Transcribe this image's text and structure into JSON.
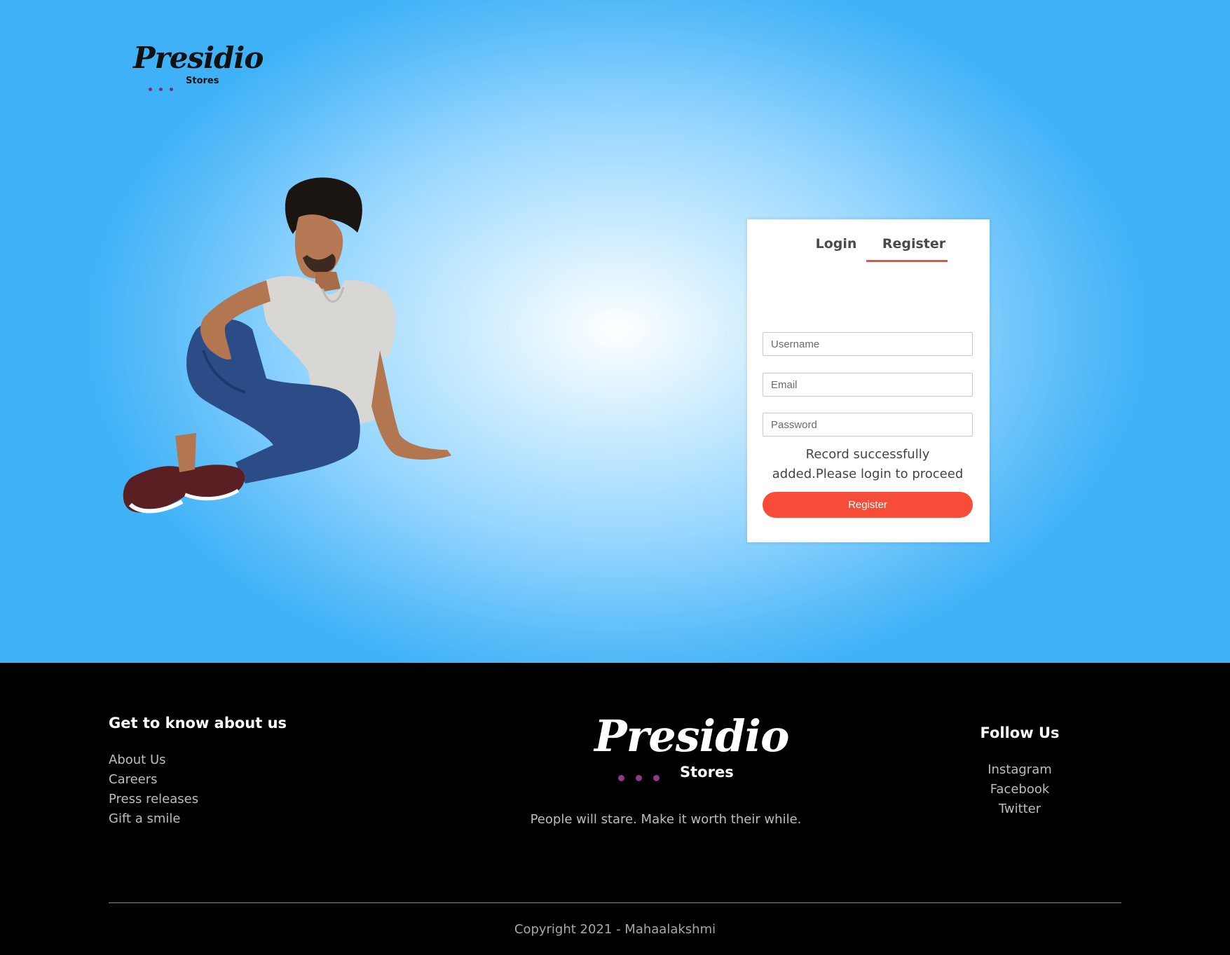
{
  "brand": {
    "logo_script": "Presidio",
    "logo_sub": "Stores",
    "accent_color": "#f64c38"
  },
  "auth_card": {
    "tabs": [
      {
        "label": "Login",
        "active": false
      },
      {
        "label": "Register",
        "active": true
      }
    ],
    "fields": {
      "username_placeholder": "Username",
      "email_placeholder": "Email",
      "password_placeholder": "Password"
    },
    "message": "Record successfully added.Please login to proceed",
    "submit_label": "Register"
  },
  "footer": {
    "about_heading": "Get to know about us",
    "about_links": [
      "About Us",
      "Careers",
      "Press releases",
      "Gift a smile"
    ],
    "tagline": "People will stare. Make it worth their while.",
    "follow_heading": "Follow Us",
    "follow_links": [
      "Instagram",
      "Facebook",
      "Twitter"
    ],
    "copyright": "Copyright 2021 - Mahaalakshmi"
  }
}
